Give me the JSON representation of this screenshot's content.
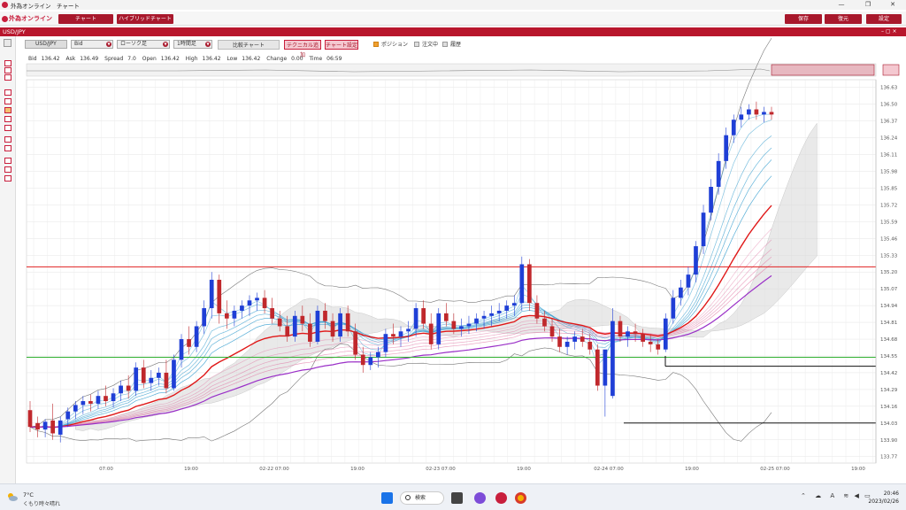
{
  "window": {
    "title": "外為オンライン　チャート",
    "minimize": "—",
    "maximize": "❐",
    "close": "✕"
  },
  "toolbar": {
    "logo": "外為オンライン",
    "tab_chart": "チャート",
    "tab_hybrid": "ハイブリッドチャート",
    "save": "保存",
    "restore": "復元",
    "settings": "設定"
  },
  "symbol_bar": {
    "symbol": "USD/JPY",
    "controls": "– ▢ ×"
  },
  "controls": {
    "pair": "USD/JPY",
    "price_type": "Bid",
    "chart_type": "ローソク足",
    "timeframe": "1時間足",
    "compare": "比較チャート",
    "technical": "テクニカル追加",
    "chart_settings": "チャート設定",
    "position_label": "ポジション",
    "order_label": "注文中",
    "history_label": "履歴"
  },
  "quote": {
    "bid_label": "Bid",
    "bid": "136.42",
    "ask_label": "Ask",
    "ask": "136.49",
    "spread_label": "Spread",
    "spread": "7.0",
    "open_label": "Open",
    "open": "136.42",
    "high_label": "High",
    "high": "136.42",
    "low_label": "Low",
    "low": "136.42",
    "change_label": "Change",
    "change": "0.00",
    "time_label": "Time",
    "time": "06:59"
  },
  "colors": {
    "brand": "#a8182c",
    "bull": "#1f3fd6",
    "bear": "#c0282c",
    "ema_fast": "#3aa0d0",
    "ema_slow": "#e070a0",
    "resistance": "#e02020",
    "support": "#30b030",
    "ma_red": "#e01818",
    "ma_purple": "#9a30c8"
  },
  "chart_data": {
    "type": "candlestick",
    "symbol": "USD/JPY",
    "timeframe": "1時間足",
    "y_ticks": [
      "136.63",
      "136.50",
      "136.37",
      "136.24",
      "136.11",
      "135.98",
      "135.85",
      "135.72",
      "135.59",
      "135.46",
      "135.33",
      "135.20",
      "135.07",
      "134.94",
      "134.81",
      "134.68",
      "134.55",
      "134.42",
      "134.29",
      "134.16",
      "134.03",
      "133.90",
      "133.77"
    ],
    "ylim": [
      133.72,
      136.69
    ],
    "x_ticks": [
      "07:00",
      "19:00",
      "02-22 07:00",
      "19:00",
      "02-23 07:00",
      "19:00",
      "02-24 07:00",
      "19:00",
      "02-25 07:00",
      "19:00"
    ],
    "horizontal_lines": [
      {
        "name": "resistance",
        "value": 135.24,
        "color": "#e02020"
      },
      {
        "name": "support",
        "value": 134.54,
        "color": "#30b030"
      }
    ],
    "candles": [
      {
        "o": 134.13,
        "h": 134.2,
        "l": 133.96,
        "c": 134.0
      },
      {
        "o": 134.03,
        "h": 134.08,
        "l": 133.92,
        "c": 133.98
      },
      {
        "o": 133.98,
        "h": 134.06,
        "l": 133.92,
        "c": 134.04
      },
      {
        "o": 134.05,
        "h": 134.18,
        "l": 133.9,
        "c": 133.95
      },
      {
        "o": 133.94,
        "h": 134.08,
        "l": 133.88,
        "c": 134.05
      },
      {
        "o": 134.06,
        "h": 134.15,
        "l": 134.0,
        "c": 134.12
      },
      {
        "o": 134.12,
        "h": 134.2,
        "l": 134.06,
        "c": 134.17
      },
      {
        "o": 134.17,
        "h": 134.24,
        "l": 134.1,
        "c": 134.2
      },
      {
        "o": 134.2,
        "h": 134.25,
        "l": 134.12,
        "c": 134.18
      },
      {
        "o": 134.18,
        "h": 134.28,
        "l": 134.14,
        "c": 134.24
      },
      {
        "o": 134.24,
        "h": 134.32,
        "l": 134.16,
        "c": 134.2
      },
      {
        "o": 134.2,
        "h": 134.3,
        "l": 134.15,
        "c": 134.26
      },
      {
        "o": 134.26,
        "h": 134.36,
        "l": 134.2,
        "c": 134.32
      },
      {
        "o": 134.32,
        "h": 134.4,
        "l": 134.22,
        "c": 134.28
      },
      {
        "o": 134.28,
        "h": 134.5,
        "l": 134.24,
        "c": 134.46
      },
      {
        "o": 134.46,
        "h": 134.52,
        "l": 134.3,
        "c": 134.34
      },
      {
        "o": 134.34,
        "h": 134.44,
        "l": 134.28,
        "c": 134.38
      },
      {
        "o": 134.38,
        "h": 134.46,
        "l": 134.32,
        "c": 134.42
      },
      {
        "o": 134.42,
        "h": 134.52,
        "l": 134.26,
        "c": 134.3
      },
      {
        "o": 134.3,
        "h": 134.56,
        "l": 134.28,
        "c": 134.52
      },
      {
        "o": 134.52,
        "h": 134.72,
        "l": 134.46,
        "c": 134.68
      },
      {
        "o": 134.68,
        "h": 134.78,
        "l": 134.56,
        "c": 134.62
      },
      {
        "o": 134.62,
        "h": 134.82,
        "l": 134.58,
        "c": 134.78
      },
      {
        "o": 134.78,
        "h": 134.98,
        "l": 134.72,
        "c": 134.92
      },
      {
        "o": 134.92,
        "h": 135.2,
        "l": 134.84,
        "c": 135.14
      },
      {
        "o": 135.14,
        "h": 135.18,
        "l": 134.8,
        "c": 134.88
      },
      {
        "o": 134.88,
        "h": 134.98,
        "l": 134.76,
        "c": 134.84
      },
      {
        "o": 134.84,
        "h": 134.94,
        "l": 134.78,
        "c": 134.9
      },
      {
        "o": 134.9,
        "h": 134.98,
        "l": 134.84,
        "c": 134.94
      },
      {
        "o": 134.94,
        "h": 135.02,
        "l": 134.86,
        "c": 134.98
      },
      {
        "o": 134.98,
        "h": 135.04,
        "l": 134.9,
        "c": 135.0
      },
      {
        "o": 135.0,
        "h": 135.06,
        "l": 134.88,
        "c": 134.92
      },
      {
        "o": 134.92,
        "h": 135.0,
        "l": 134.8,
        "c": 134.84
      },
      {
        "o": 134.84,
        "h": 134.9,
        "l": 134.74,
        "c": 134.78
      },
      {
        "o": 134.78,
        "h": 134.86,
        "l": 134.66,
        "c": 134.7
      },
      {
        "o": 134.7,
        "h": 134.9,
        "l": 134.66,
        "c": 134.86
      },
      {
        "o": 134.86,
        "h": 134.94,
        "l": 134.74,
        "c": 134.8
      },
      {
        "o": 134.8,
        "h": 134.88,
        "l": 134.62,
        "c": 134.66
      },
      {
        "o": 134.66,
        "h": 134.94,
        "l": 134.64,
        "c": 134.9
      },
      {
        "o": 134.9,
        "h": 134.96,
        "l": 134.76,
        "c": 134.82
      },
      {
        "o": 134.82,
        "h": 134.88,
        "l": 134.66,
        "c": 134.7
      },
      {
        "o": 134.7,
        "h": 134.92,
        "l": 134.66,
        "c": 134.88
      },
      {
        "o": 134.88,
        "h": 134.94,
        "l": 134.7,
        "c": 134.74
      },
      {
        "o": 134.74,
        "h": 134.8,
        "l": 134.52,
        "c": 134.56
      },
      {
        "o": 134.56,
        "h": 134.62,
        "l": 134.42,
        "c": 134.48
      },
      {
        "o": 134.48,
        "h": 134.58,
        "l": 134.44,
        "c": 134.54
      },
      {
        "o": 134.54,
        "h": 134.62,
        "l": 134.46,
        "c": 134.58
      },
      {
        "o": 134.58,
        "h": 134.76,
        "l": 134.54,
        "c": 134.72
      },
      {
        "o": 134.72,
        "h": 134.8,
        "l": 134.64,
        "c": 134.7
      },
      {
        "o": 134.7,
        "h": 134.78,
        "l": 134.62,
        "c": 134.74
      },
      {
        "o": 134.74,
        "h": 134.82,
        "l": 134.66,
        "c": 134.76
      },
      {
        "o": 134.76,
        "h": 134.96,
        "l": 134.7,
        "c": 134.92
      },
      {
        "o": 134.92,
        "h": 134.98,
        "l": 134.76,
        "c": 134.8
      },
      {
        "o": 134.8,
        "h": 134.88,
        "l": 134.6,
        "c": 134.64
      },
      {
        "o": 134.64,
        "h": 134.92,
        "l": 134.6,
        "c": 134.88
      },
      {
        "o": 134.88,
        "h": 134.96,
        "l": 134.78,
        "c": 134.82
      },
      {
        "o": 134.82,
        "h": 134.88,
        "l": 134.72,
        "c": 134.76
      },
      {
        "o": 134.76,
        "h": 134.84,
        "l": 134.7,
        "c": 134.78
      },
      {
        "o": 134.78,
        "h": 134.86,
        "l": 134.72,
        "c": 134.8
      },
      {
        "o": 134.8,
        "h": 134.88,
        "l": 134.74,
        "c": 134.84
      },
      {
        "o": 134.84,
        "h": 134.9,
        "l": 134.76,
        "c": 134.86
      },
      {
        "o": 134.86,
        "h": 134.94,
        "l": 134.78,
        "c": 134.88
      },
      {
        "o": 134.88,
        "h": 134.96,
        "l": 134.82,
        "c": 134.9
      },
      {
        "o": 134.9,
        "h": 134.98,
        "l": 134.84,
        "c": 134.94
      },
      {
        "o": 134.94,
        "h": 135.02,
        "l": 134.86,
        "c": 134.96
      },
      {
        "o": 134.96,
        "h": 135.32,
        "l": 134.9,
        "c": 135.26
      },
      {
        "o": 135.26,
        "h": 135.3,
        "l": 134.9,
        "c": 134.96
      },
      {
        "o": 134.96,
        "h": 135.02,
        "l": 134.8,
        "c": 134.84
      },
      {
        "o": 134.84,
        "h": 134.9,
        "l": 134.74,
        "c": 134.78
      },
      {
        "o": 134.78,
        "h": 134.84,
        "l": 134.66,
        "c": 134.7
      },
      {
        "o": 134.7,
        "h": 134.76,
        "l": 134.58,
        "c": 134.62
      },
      {
        "o": 134.62,
        "h": 134.7,
        "l": 134.56,
        "c": 134.66
      },
      {
        "o": 134.66,
        "h": 134.74,
        "l": 134.6,
        "c": 134.7
      },
      {
        "o": 134.7,
        "h": 134.76,
        "l": 134.62,
        "c": 134.66
      },
      {
        "o": 134.66,
        "h": 134.72,
        "l": 134.56,
        "c": 134.6
      },
      {
        "o": 134.6,
        "h": 134.64,
        "l": 134.28,
        "c": 134.32
      },
      {
        "o": 134.32,
        "h": 134.4,
        "l": 134.08,
        "c": 134.6
      },
      {
        "o": 134.24,
        "h": 134.92,
        "l": 134.22,
        "c": 134.82
      },
      {
        "o": 134.82,
        "h": 134.86,
        "l": 134.66,
        "c": 134.7
      },
      {
        "o": 134.7,
        "h": 134.78,
        "l": 134.62,
        "c": 134.74
      },
      {
        "o": 134.74,
        "h": 134.8,
        "l": 134.66,
        "c": 134.72
      },
      {
        "o": 134.72,
        "h": 134.76,
        "l": 134.62,
        "c": 134.66
      },
      {
        "o": 134.66,
        "h": 134.72,
        "l": 134.58,
        "c": 134.64
      },
      {
        "o": 134.64,
        "h": 134.68,
        "l": 134.56,
        "c": 134.6
      },
      {
        "o": 134.6,
        "h": 134.88,
        "l": 134.58,
        "c": 134.84
      },
      {
        "o": 134.84,
        "h": 135.06,
        "l": 134.8,
        "c": 135.0
      },
      {
        "o": 135.0,
        "h": 135.14,
        "l": 134.94,
        "c": 135.08
      },
      {
        "o": 135.08,
        "h": 135.24,
        "l": 135.02,
        "c": 135.18
      },
      {
        "o": 135.18,
        "h": 135.44,
        "l": 135.12,
        "c": 135.4
      },
      {
        "o": 135.4,
        "h": 135.72,
        "l": 135.34,
        "c": 135.66
      },
      {
        "o": 135.66,
        "h": 135.92,
        "l": 135.6,
        "c": 135.86
      },
      {
        "o": 135.86,
        "h": 136.12,
        "l": 135.8,
        "c": 136.06
      },
      {
        "o": 136.06,
        "h": 136.32,
        "l": 136.0,
        "c": 136.26
      },
      {
        "o": 136.26,
        "h": 136.42,
        "l": 136.2,
        "c": 136.38
      },
      {
        "o": 136.38,
        "h": 136.48,
        "l": 136.32,
        "c": 136.42
      },
      {
        "o": 136.42,
        "h": 136.5,
        "l": 136.38,
        "c": 136.46
      },
      {
        "o": 136.46,
        "h": 136.52,
        "l": 136.38,
        "c": 136.42
      },
      {
        "o": 136.42,
        "h": 136.48,
        "l": 136.36,
        "c": 136.44
      },
      {
        "o": 136.44,
        "h": 136.48,
        "l": 136.38,
        "c": 136.42
      }
    ]
  },
  "taskbar": {
    "temp": "7°C",
    "condition": "くもり時々晴れ",
    "search": "検索",
    "time": "20:46",
    "date": "2023/02/26",
    "ime": "A"
  }
}
